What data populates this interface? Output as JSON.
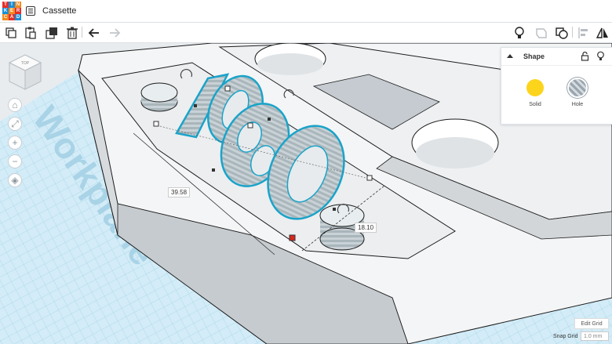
{
  "app": {
    "logo_letters": [
      "TIN",
      "KER",
      "CAD"
    ],
    "document_title": "Cassette"
  },
  "toolbar": {
    "left_tools": [
      "copy-icon",
      "paste-icon",
      "duplicate-icon",
      "delete-icon",
      "undo-icon",
      "redo-icon"
    ],
    "right_tools": [
      "light-bulb-icon",
      "group-icon",
      "align-icon",
      "mirror-icon"
    ]
  },
  "viewcube": {
    "face_label": "TOP"
  },
  "workplane": {
    "label": "Workplane"
  },
  "dimensions": {
    "length": "39.58",
    "width": "18.10"
  },
  "shape_panel": {
    "title": "Shape",
    "solid_label": "Solid",
    "hole_label": "Hole",
    "solid_color": "#fdd41c",
    "hole_pattern": "striped-gray"
  },
  "grid": {
    "edit_grid_label": "Edit Grid",
    "snap_grid_label": "Snap Grid",
    "snap_grid_value": "1.0 mm"
  },
  "colors": {
    "accent": "#1aa3c9",
    "workplane_blue": "#bfe3f2",
    "handle_red": "#d9261c"
  }
}
